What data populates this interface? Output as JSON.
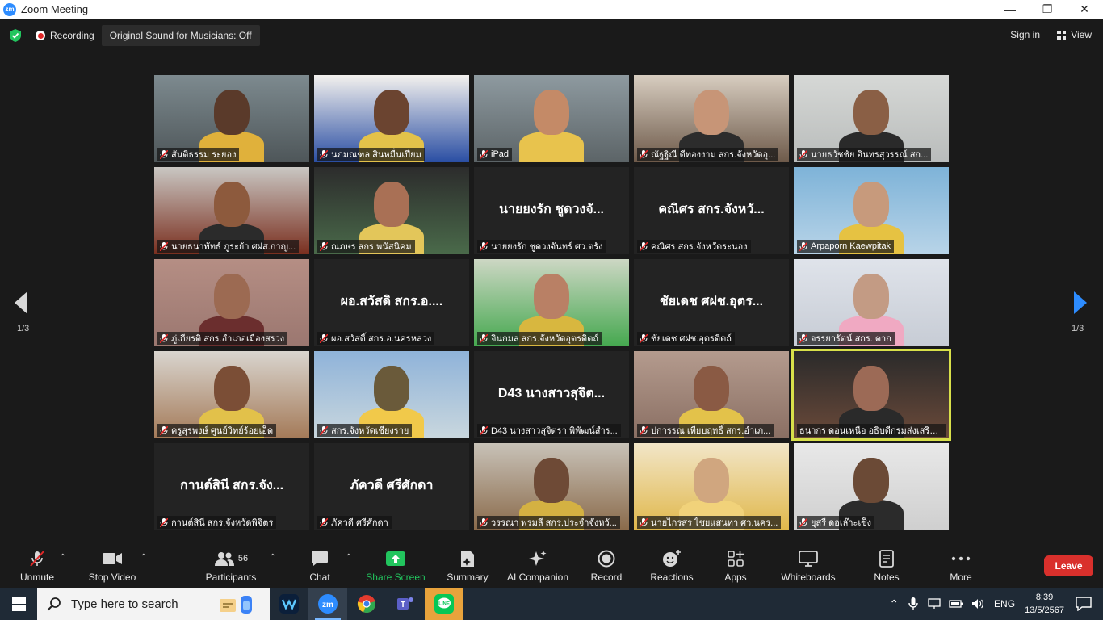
{
  "window": {
    "title": "Zoom Meeting",
    "logo_text": "zm",
    "minimize": "—",
    "maximize": "❐",
    "close": "✕"
  },
  "topbar": {
    "recording_label": "Recording",
    "original_sound": "Original Sound for Musicians: Off",
    "sign_in": "Sign in",
    "view": "View"
  },
  "pager": {
    "left": "1/3",
    "right": "1/3"
  },
  "participants": [
    {
      "name": "สันติธรรม ระยอง",
      "video": true
    },
    {
      "name": "นภมณฑล สินหมื่นเปียม",
      "video": true
    },
    {
      "name": "iPad",
      "video": true
    },
    {
      "name": "ณัฐฐิณี ดีทองงาม  สกร.จังหวัดอุ...",
      "video": true
    },
    {
      "name": "นายธวัชชัย  อินทรสุวรรณ์  สก...",
      "video": true
    },
    {
      "name": "นายธนาพัทธ์  ภูระย้า ศฝส.กาญ...",
      "video": true
    },
    {
      "name": "ณภษร สกร.พนัสนิคม",
      "video": true
    },
    {
      "name": "นายยงรัก  ชูดวงจันทร์ ศว.ตรัง",
      "video": false,
      "center": "นายยงรัก  ชูดวงจั..."
    },
    {
      "name": "คณิศร สกร.จังหวัดระนอง",
      "video": false,
      "center": "คณิศร สกร.จังหวั..."
    },
    {
      "name": "Arpaporn Kaewpitak",
      "video": true
    },
    {
      "name": "ภู่เกียรติ สกร.อำเภอเมืองสรวง",
      "video": true
    },
    {
      "name": "ผอ.สวัสดิ์ สกร.อ.นครหลวง",
      "video": false,
      "center": "ผอ.สวัสดิ สกร.อ...."
    },
    {
      "name": "จินกมล  สกร.จังหวัดอุตรดิตถ์",
      "video": true
    },
    {
      "name": "ชัยเดช ศฝช.อุตรดิตถ์",
      "video": false,
      "center": "ชัยเดช ศฝช.อุตร..."
    },
    {
      "name": "จรรยารัตน์ สกร. ตาก",
      "video": true
    },
    {
      "name": "ครูสุรพงษ์ ศูนย์วิทย์ร้อยเอ็ด",
      "video": true
    },
    {
      "name": "สกร.จังหวัดเชียงราย",
      "video": true
    },
    {
      "name": "D43 นางสาวสุจิตรา พิพัฒน์สำร...",
      "video": false,
      "center": "D43 นางสาวสุจิต..."
    },
    {
      "name": "ปการรณ เทียบฤทธิ์ สกร.อำเภ...",
      "video": true
    },
    {
      "name": "ธนากร ดอนเหนือ อธิบดีกรมส่งเสริม...",
      "video": true,
      "active": true,
      "no_mic": true
    },
    {
      "name": "กานต์สินี สกร.จังหวัดพิจิตร",
      "video": false,
      "center": "กานต์สินี สกร.จัง..."
    },
    {
      "name": "ภัควดี ศรีศักดา",
      "video": false,
      "center": "ภัควดี ศรีศักดา"
    },
    {
      "name": "วรรณา พรมลี สกร.ประจำจังหวั...",
      "video": true
    },
    {
      "name": "นายไกรสร ไชยแสนทา ศว.นคร...",
      "video": true
    },
    {
      "name": "ยุสรี ดอเล๊าะเซ็ง",
      "video": true
    }
  ],
  "toolbar": {
    "unmute": "Unmute",
    "stop_video": "Stop Video",
    "participants": "Participants",
    "participant_count": "56",
    "chat": "Chat",
    "share_screen": "Share Screen",
    "summary": "Summary",
    "ai_companion": "AI Companion",
    "record": "Record",
    "reactions": "Reactions",
    "apps": "Apps",
    "whiteboards": "Whiteboards",
    "notes": "Notes",
    "more": "More",
    "leave": "Leave"
  },
  "taskbar": {
    "search_placeholder": "Type here to search",
    "language": "ENG",
    "time": "8:39",
    "date": "13/5/2567"
  },
  "colors": {
    "accent": "#2d8cff",
    "leave": "#d9302c",
    "share": "#22c55e",
    "active_speaker": "#d8e04a"
  }
}
